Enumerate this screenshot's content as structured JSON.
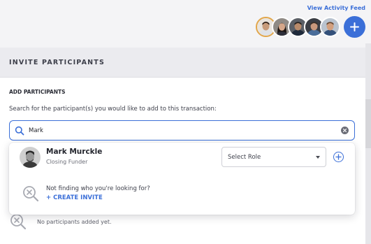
{
  "header": {
    "view_activity_feed": "View Activity Feed",
    "avatars": [
      {
        "name": "participant-1",
        "skin": "#c79b7a",
        "hair": "#2a1d16",
        "shirt": "#dfe2e8"
      },
      {
        "name": "participant-2",
        "skin": "#d5a78a",
        "hair": "#1b1411",
        "shirt": "#2d2f3a"
      },
      {
        "name": "participant-3",
        "skin": "#b88a6a",
        "hair": "#26201c",
        "shirt": "#1f2a3b"
      },
      {
        "name": "participant-4",
        "skin": "#c9987c",
        "hair": "#3a2f28",
        "shirt": "#4a6d9a"
      },
      {
        "name": "participant-5",
        "skin": "#d3a07f",
        "hair": "#6a4a34",
        "shirt": "#33507a"
      }
    ],
    "accent_color": "#3b6fd8"
  },
  "panel": {
    "title": "INVITE PARTICIPANTS",
    "section_title": "ADD PARTICIPANTS",
    "helper_text": "Search for the participant(s) you would like to add to this transaction:",
    "search": {
      "value": "Mark",
      "icon": "search-icon",
      "clear_icon": "clear-icon"
    },
    "empty_state": "No participants added yet."
  },
  "dropdown": {
    "result": {
      "name": "Mark Murckle",
      "role": "Closing Funder",
      "select_placeholder": "Select Role",
      "add_icon": "plus-circle-icon"
    },
    "not_found_text": "Not finding who you're looking for?",
    "create_invite_label": "+ CREATE INVITE"
  }
}
